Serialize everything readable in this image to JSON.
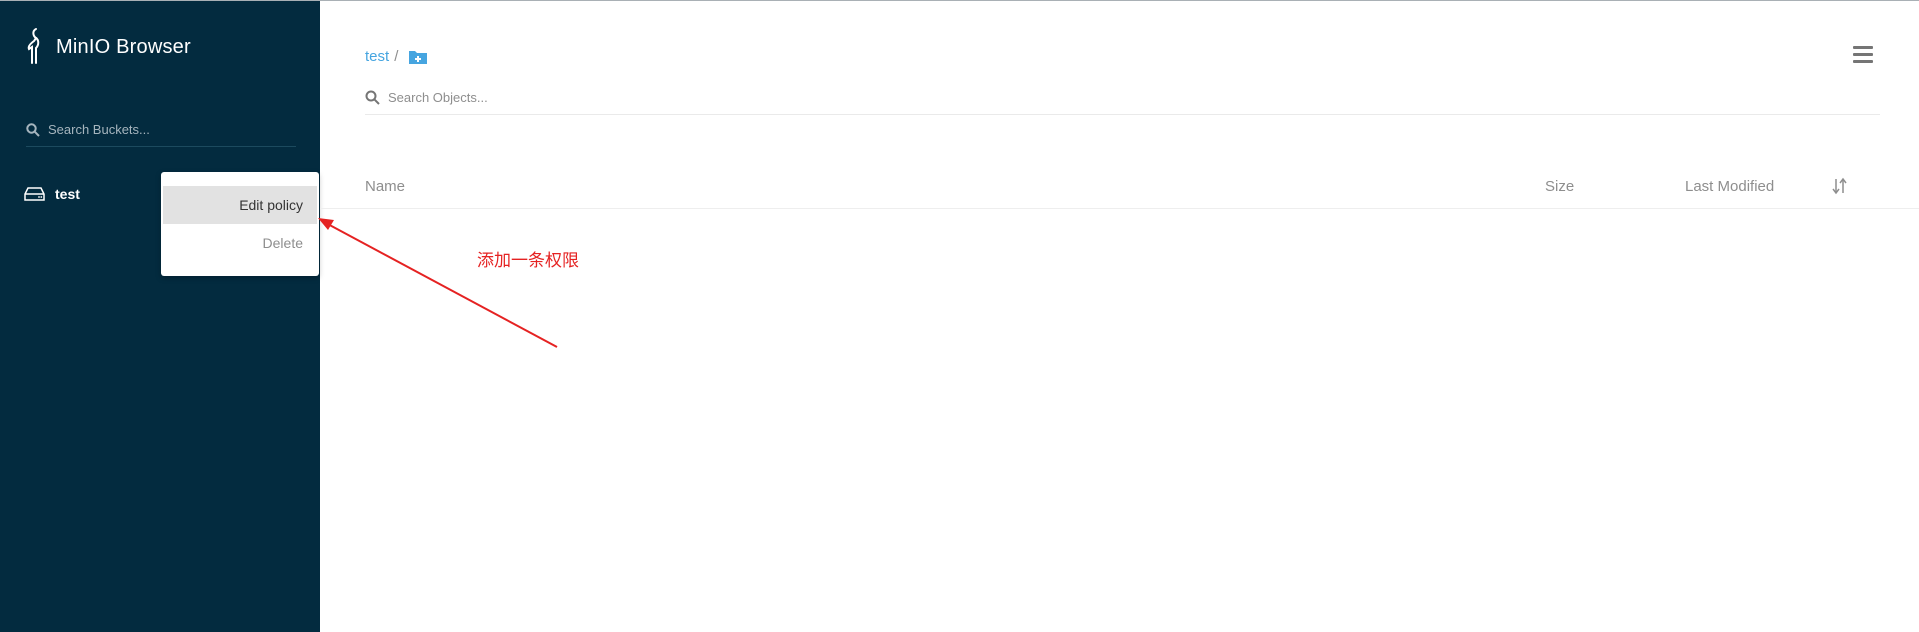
{
  "app": {
    "title": "MinIO Browser"
  },
  "sidebar": {
    "search_placeholder": "Search Buckets...",
    "buckets": [
      {
        "name": "test"
      }
    ]
  },
  "context_menu": {
    "items": [
      {
        "label": "Edit policy"
      },
      {
        "label": "Delete"
      }
    ]
  },
  "main": {
    "breadcrumb": {
      "bucket": "test",
      "separator": "/"
    },
    "search_placeholder": "Search Objects...",
    "table": {
      "columns": [
        "Name",
        "Size",
        "Last Modified"
      ],
      "rows": []
    }
  },
  "annotation": {
    "text": "添加一条权限",
    "color": "#e52222"
  },
  "colors": {
    "sidebar_bg": "#032b3f",
    "link": "#46a5e0"
  }
}
